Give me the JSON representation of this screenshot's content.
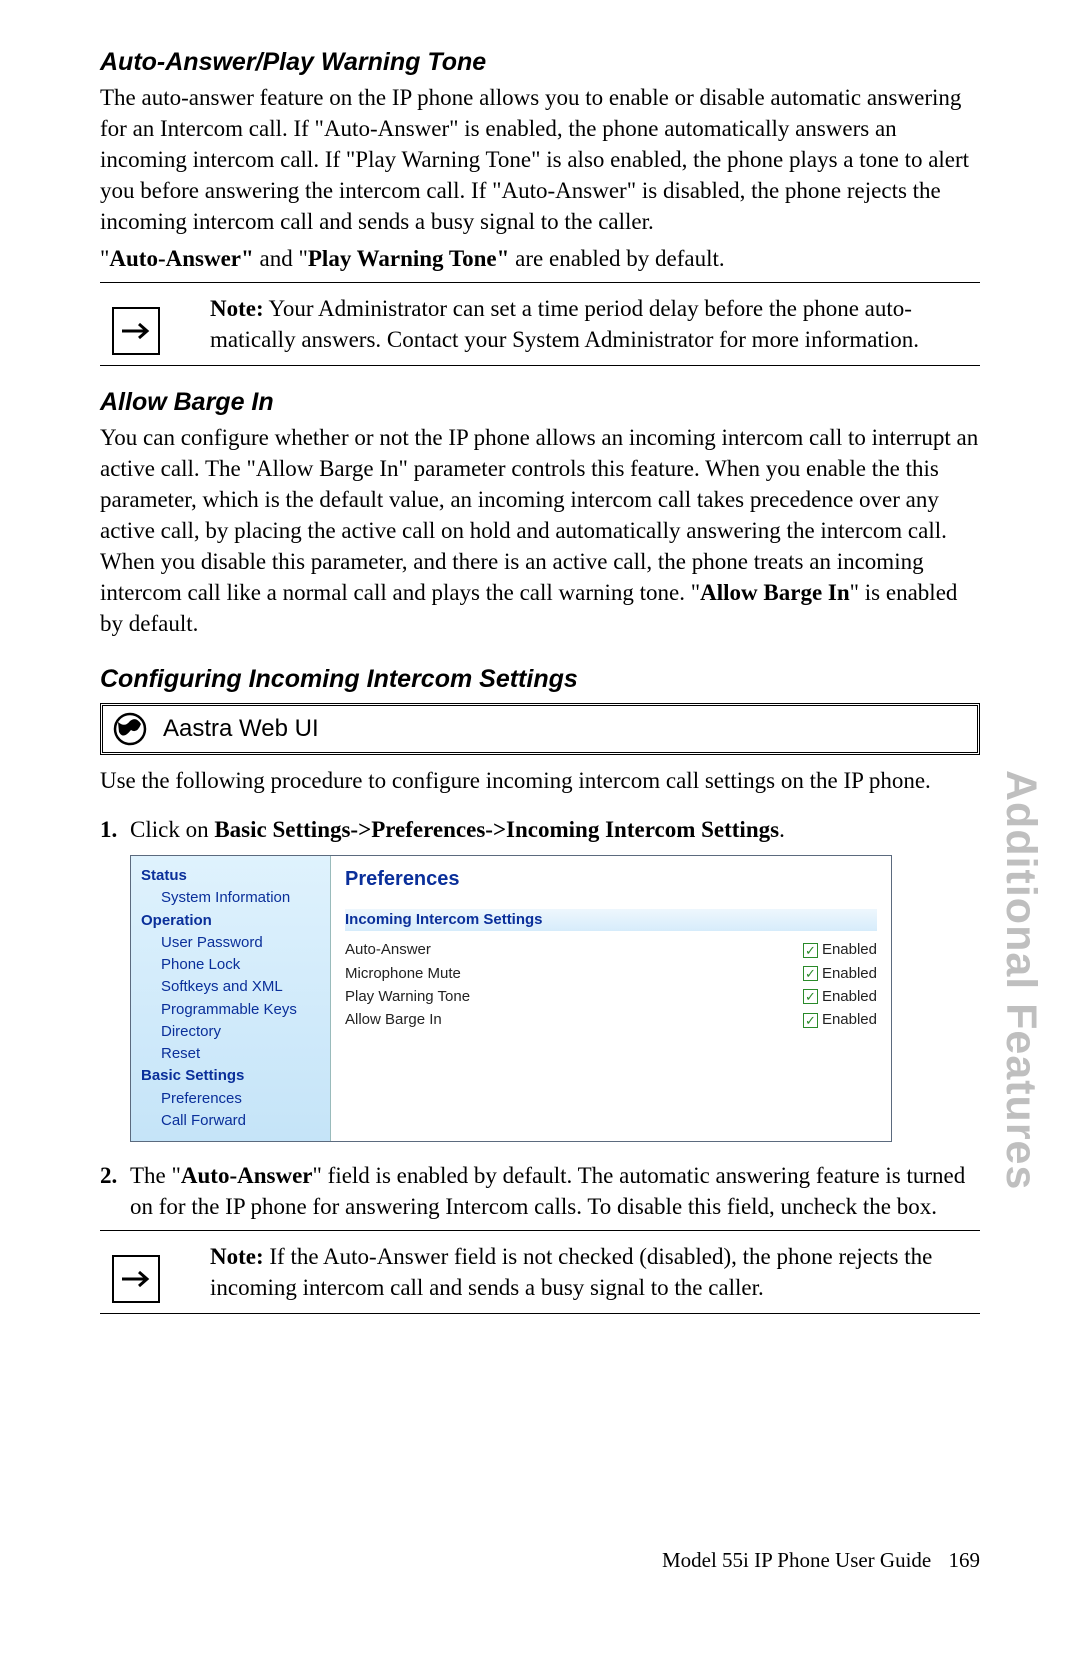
{
  "side_tab": "Additional Features",
  "h_auto": "Auto-Answer/Play Warning Tone",
  "p_auto_1": "The auto-answer feature on the IP phone allows you to enable or disable automatic answering for an Intercom call. If \"Auto-Answer\" is enabled, the phone automatically answers an incoming intercom call. If \"Play Warning Tone\" is also enabled, the phone plays a tone to alert you before answering the intercom call. If \"Auto-Answer\" is disabled, the phone rejects the incoming intercom call and sends a busy signal to the caller.",
  "p_auto_2_a": "\"",
  "p_auto_2_b": "Auto-Answer\"",
  "p_auto_2_c": " and \"",
  "p_auto_2_d": "Play Warning Tone\"",
  "p_auto_2_e": " are enabled by default.",
  "note1_label": "Note:",
  "note1_text": " Your Administrator can set a time period delay before the phone auto­matically answers. Contact your System Administrator for more infor­mation.",
  "h_barge": "Allow Barge In",
  "p_barge_a": "You can configure whether or not the IP phone allows an incoming intercom call to interrupt an active call. The \"Allow Barge In\" parameter controls this feature. When you enable the this parameter, which is the default value, an incoming intercom call takes precedence over any active call, by placing the active call on hold and automatically answering the intercom call. When you disable this parameter, and there is an active call, the phone treats an incoming intercom call like a normal call and plays the call warning tone. \"",
  "p_barge_b": "Allow Barge In",
  "p_barge_c": "\" is enabled by default.",
  "h_cfg": "Configuring Incoming Intercom Settings",
  "webui_label": "Aastra Web UI",
  "p_use": "Use the following procedure to configure incoming intercom call settings on the IP phone.",
  "step1_num": "1.",
  "step1_a": "Click on ",
  "step1_b": "Basic Settings->Preferences->Incoming Intercom Settings",
  "step1_c": ".",
  "ui": {
    "nav": {
      "status": "Status",
      "status_items": [
        "System Information"
      ],
      "operation": "Operation",
      "operation_items": [
        "User Password",
        "Phone Lock",
        "Softkeys and XML",
        "Programmable Keys",
        "Directory",
        "Reset"
      ],
      "basic": "Basic Settings",
      "basic_items": [
        "Preferences",
        "Call Forward"
      ]
    },
    "title": "Preferences",
    "section": "Incoming Intercom Settings",
    "rows": [
      {
        "label": "Auto-Answer",
        "val": "Enabled",
        "checked": true
      },
      {
        "label": "Microphone Mute",
        "val": "Enabled",
        "checked": true
      },
      {
        "label": "Play Warning Tone",
        "val": "Enabled",
        "checked": true
      },
      {
        "label": "Allow Barge In",
        "val": "Enabled",
        "checked": true
      }
    ]
  },
  "step2_num": "2.",
  "step2_a": "The \"",
  "step2_b": "Auto-Answer",
  "step2_c": "\" field is enabled by default. The automatic answering feature is turned on for the IP phone for answering Intercom calls. To disable this field, uncheck the box.",
  "note2_label": "Note:",
  "note2_text": " If the Auto-Answer field is not checked (disabled), the phone rejects the incoming intercom call and sends a busy signal to the caller.",
  "footer_text": "Model 55i IP Phone User Guide",
  "page_num": "169"
}
